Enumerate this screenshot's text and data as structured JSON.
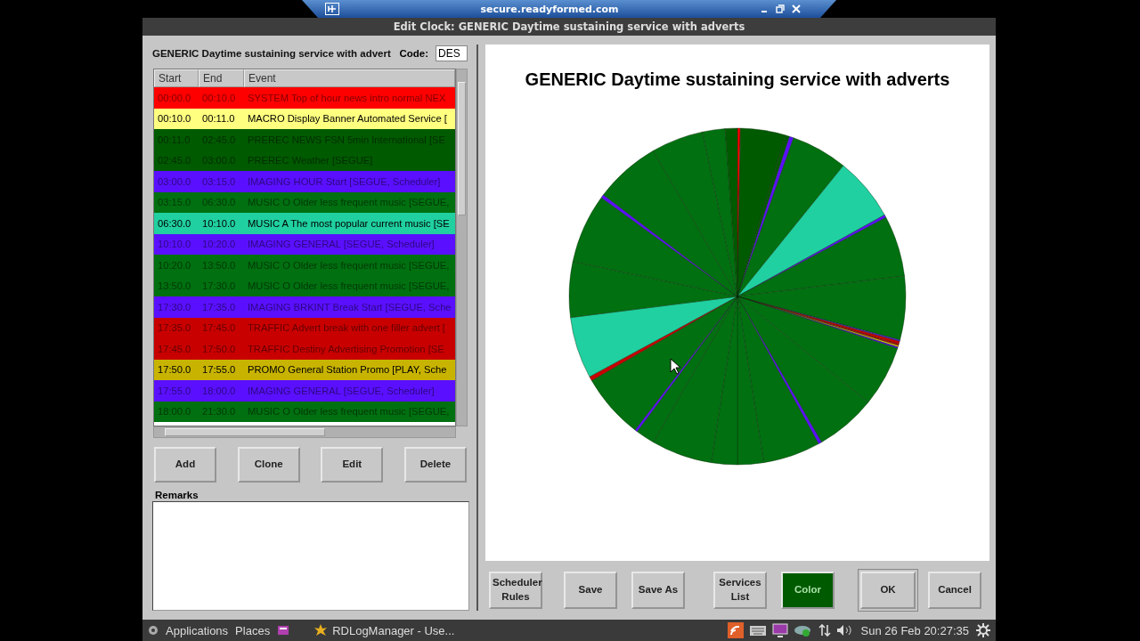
{
  "remote_bar": {
    "title": "secure.readyformed.com"
  },
  "window": {
    "title": "Edit Clock: GENERIC Daytime sustaining service with adverts"
  },
  "clock": {
    "name": "GENERIC Daytime sustaining service with advert",
    "code_label": "Code:",
    "code": "DES"
  },
  "table": {
    "columns": [
      "Start",
      "End",
      "Event"
    ],
    "rows": [
      {
        "start": "00:00.0",
        "end": "00:10.0",
        "event": "SYSTEM Top of hour news intro normal NEX",
        "color": "#ff0000"
      },
      {
        "start": "00:10.0",
        "end": "00:11.0",
        "event": "MACRO Display Banner Automated Service [",
        "color": "#ffff80"
      },
      {
        "start": "00:11.0",
        "end": "02:45.0",
        "event": "PREREC NEWS FSN 5min International [SE",
        "color": "#005a00"
      },
      {
        "start": "02:45.0",
        "end": "03:00.0",
        "event": "PREREC Weather [SEGUE]",
        "color": "#005a00"
      },
      {
        "start": "03:00.0",
        "end": "03:15.0",
        "event": "IMAGING HOUR Start [SEGUE, Scheduler]",
        "color": "#5a10ff"
      },
      {
        "start": "03:15.0",
        "end": "06:30.0",
        "event": "MUSIC O Older less frequent music [SEGUE,",
        "color": "#007010"
      },
      {
        "start": "06:30.0",
        "end": "10:10.0",
        "event": "MUSIC A The most popular current music [SE",
        "color": "#20d0a0"
      },
      {
        "start": "10:10.0",
        "end": "10:20.0",
        "event": "IMAGING GENERAL [SEGUE, Scheduler]",
        "color": "#5a10ff"
      },
      {
        "start": "10:20.0",
        "end": "13:50.0",
        "event": "MUSIC O Older less frequent music [SEGUE,",
        "color": "#007010"
      },
      {
        "start": "13:50.0",
        "end": "17:30.0",
        "event": "MUSIC O Older less frequent music [SEGUE,",
        "color": "#007010"
      },
      {
        "start": "17:30.0",
        "end": "17:35.0",
        "event": "IMAGING BRKINT Break Start [SEGUE, Sche",
        "color": "#5a10ff"
      },
      {
        "start": "17:35.0",
        "end": "17:45.0",
        "event": "TRAFFIC Advert break with one filler advert [",
        "color": "#c80000"
      },
      {
        "start": "17:45.0",
        "end": "17:50.0",
        "event": "TRAFFIC Destiny Advertising Promotion [SE",
        "color": "#c80000"
      },
      {
        "start": "17:50.0",
        "end": "17:55.0",
        "event": "PROMO General Station Promo [PLAY, Sche",
        "color": "#c8b400"
      },
      {
        "start": "17:55.0",
        "end": "18:00.0",
        "event": "IMAGING GENERAL [SEGUE, Scheduler]",
        "color": "#5a10ff"
      },
      {
        "start": "18:00.0",
        "end": "21:30.0",
        "event": "MUSIC O Older less frequent music [SEGUE,",
        "color": "#007010"
      }
    ]
  },
  "list_buttons": [
    "Add",
    "Clone",
    "Edit",
    "Delete"
  ],
  "remarks": {
    "label": "Remarks"
  },
  "chart_title": "GENERIC Daytime sustaining service with adverts",
  "buttons": [
    {
      "label": "Scheduler Rules",
      "kind": "plain"
    },
    {
      "label": "Save",
      "kind": "plain"
    },
    {
      "label": "Save As",
      "kind": "plain"
    },
    {
      "label": "Services List",
      "kind": "plain"
    },
    {
      "label": "Color",
      "kind": "color",
      "color": "#005a00"
    },
    {
      "label": "OK",
      "kind": "default"
    },
    {
      "label": "Cancel",
      "kind": "plain"
    }
  ],
  "taskbar": {
    "menus": [
      "Applications",
      "Places"
    ],
    "task": "RDLogManager - Use...",
    "clock": "Sun 26 Feb 20:27:35"
  }
}
